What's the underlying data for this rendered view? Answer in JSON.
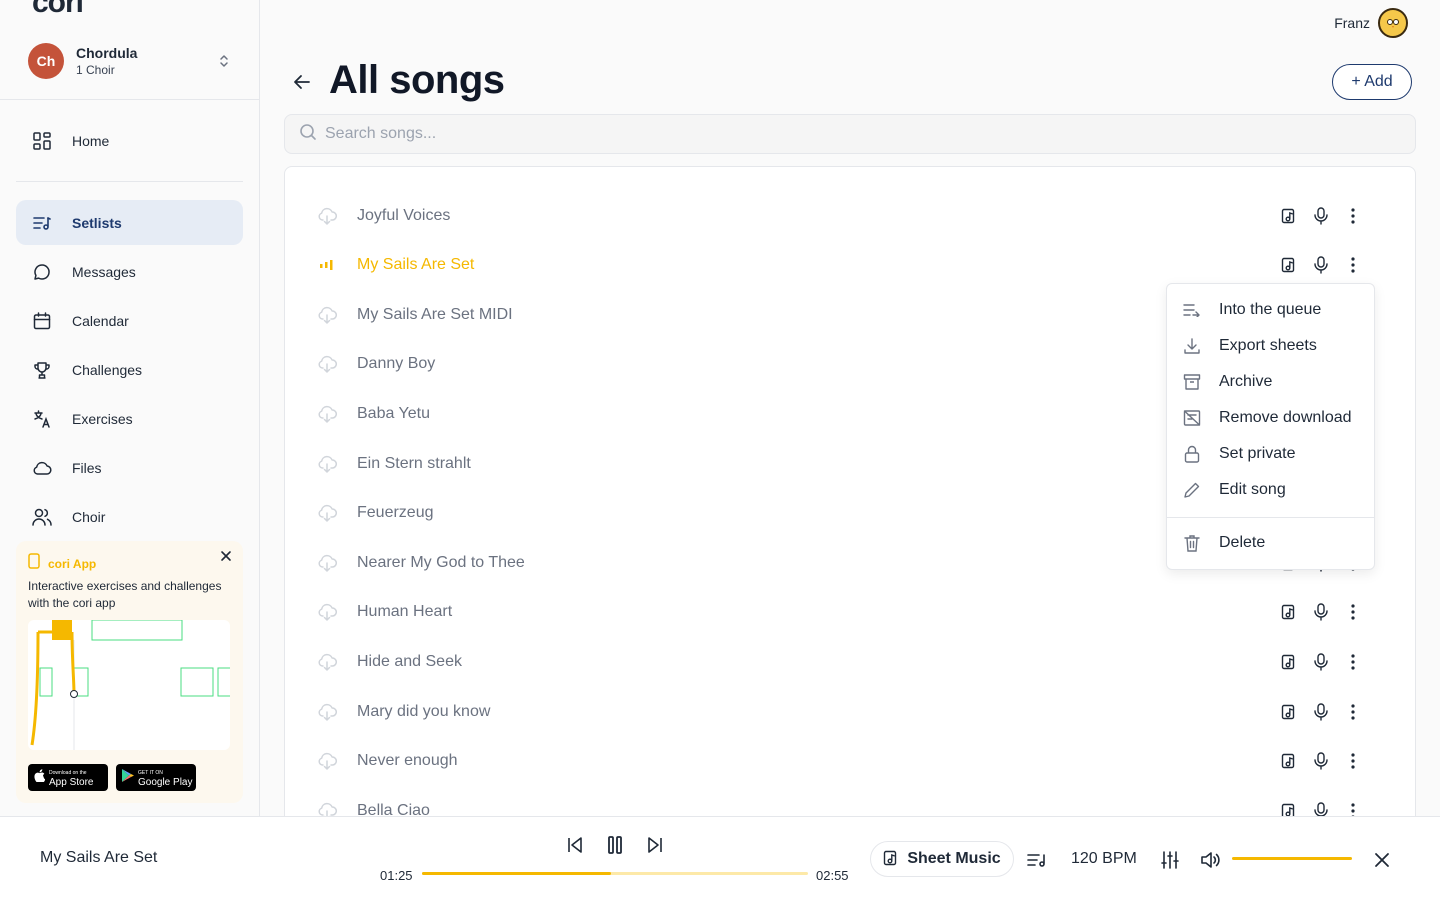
{
  "app": {
    "logo": "cori"
  },
  "org": {
    "initials": "Ch",
    "name": "Chordula",
    "subtitle": "1 Choir"
  },
  "sidebar": {
    "items": [
      {
        "label": "Home",
        "icon": "home-grid-icon"
      },
      {
        "label": "Setlists",
        "icon": "setlist-icon",
        "active": true
      },
      {
        "label": "Messages",
        "icon": "message-icon"
      },
      {
        "label": "Calendar",
        "icon": "calendar-icon"
      },
      {
        "label": "Challenges",
        "icon": "trophy-icon"
      },
      {
        "label": "Exercises",
        "icon": "exercises-icon"
      },
      {
        "label": "Files",
        "icon": "cloud-icon"
      },
      {
        "label": "Choir",
        "icon": "users-icon"
      }
    ]
  },
  "promo": {
    "title": "cori App",
    "text": "Interactive exercises and challenges with the cori app",
    "appstore_small": "Download on the",
    "appstore_big": "App Store",
    "googleplay_small": "GET IT ON",
    "googleplay_big": "Google Play"
  },
  "header": {
    "user_name": "Franz",
    "page_title": "All songs",
    "add_label": "+ Add"
  },
  "search": {
    "placeholder": "Search songs...",
    "value": ""
  },
  "songs": [
    {
      "title": "Joyful Voices"
    },
    {
      "title": "My Sails Are Set",
      "playing": true
    },
    {
      "title": "My Sails Are Set MIDI"
    },
    {
      "title": "Danny Boy"
    },
    {
      "title": "Baba Yetu"
    },
    {
      "title": "Ein Stern strahlt"
    },
    {
      "title": "Feuerzeug"
    },
    {
      "title": "Nearer My God to Thee"
    },
    {
      "title": "Human Heart"
    },
    {
      "title": "Hide and Seek"
    },
    {
      "title": "Mary did you know"
    },
    {
      "title": "Never enough"
    },
    {
      "title": "Bella Ciao"
    }
  ],
  "context_menu": {
    "items": [
      {
        "label": "Into the queue",
        "icon": "queue-icon"
      },
      {
        "label": "Export sheets",
        "icon": "download-icon"
      },
      {
        "label": "Archive",
        "icon": "archive-icon"
      },
      {
        "label": "Remove download",
        "icon": "remove-download-icon"
      },
      {
        "label": "Set private",
        "icon": "lock-icon"
      },
      {
        "label": "Edit song",
        "icon": "pencil-icon"
      },
      {
        "label": "Delete",
        "icon": "trash-icon"
      }
    ]
  },
  "player": {
    "now_playing": "My Sails Are Set",
    "elapsed": "01:25",
    "duration": "02:55",
    "progress": 0.49,
    "sheet_music_label": "Sheet Music",
    "bpm": "120 BPM",
    "volume": 1.0
  },
  "colors": {
    "accent": "#f5b800",
    "brand": "#1e3a6e",
    "active_nav_bg": "#e6ecf5",
    "avatar": "#c4533a"
  }
}
